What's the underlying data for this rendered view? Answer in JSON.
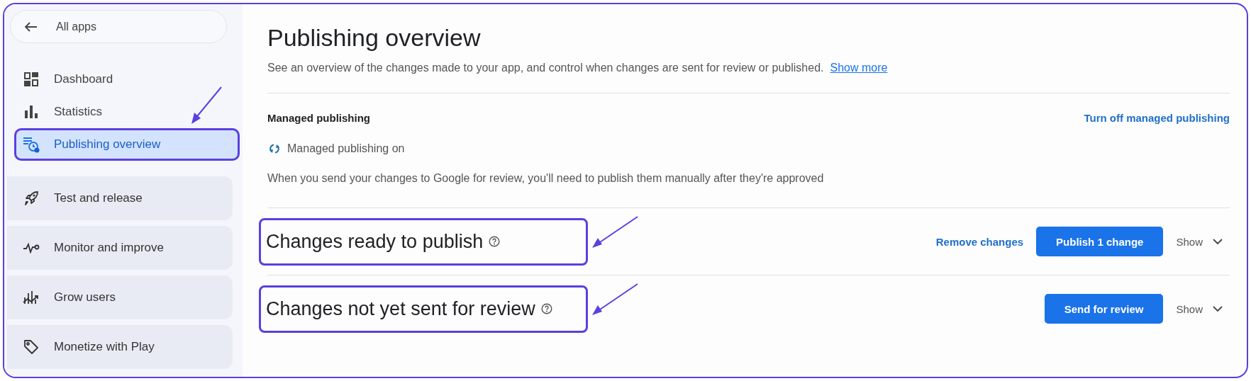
{
  "sidebar": {
    "back": {
      "label": "All apps"
    },
    "items": [
      {
        "kind": "link",
        "label": "Dashboard",
        "selected": false,
        "highlighted": false
      },
      {
        "kind": "link",
        "label": "Statistics",
        "selected": false,
        "highlighted": false
      },
      {
        "kind": "link",
        "label": "Publishing overview",
        "selected": true,
        "highlighted": true
      },
      {
        "kind": "group",
        "label": "Test and release",
        "selected": false,
        "highlighted": false
      },
      {
        "kind": "group",
        "label": "Monitor and improve",
        "selected": false,
        "highlighted": false
      },
      {
        "kind": "group",
        "label": "Grow users",
        "selected": false,
        "highlighted": false
      },
      {
        "kind": "group",
        "label": "Monetize with Play",
        "selected": false,
        "highlighted": false
      }
    ]
  },
  "page": {
    "title": "Publishing overview",
    "description": "See an overview of the changes made to your app, and control when changes are sent for review or published.",
    "show_more": "Show more"
  },
  "managed_publishing": {
    "heading": "Managed publishing",
    "action": "Turn off managed publishing",
    "status": "Managed publishing on",
    "on": true,
    "note": "When you send your changes to Google for review, you'll need to publish them manually after they're approved"
  },
  "sections": [
    {
      "title": "Changes ready to publish",
      "highlighted": true,
      "secondary_action": "Remove changes",
      "primary_action": "Publish 1 change",
      "toggle": "Show"
    },
    {
      "title": "Changes not yet sent for review",
      "highlighted": true,
      "primary_action": "Send for review",
      "toggle": "Show"
    }
  ]
}
